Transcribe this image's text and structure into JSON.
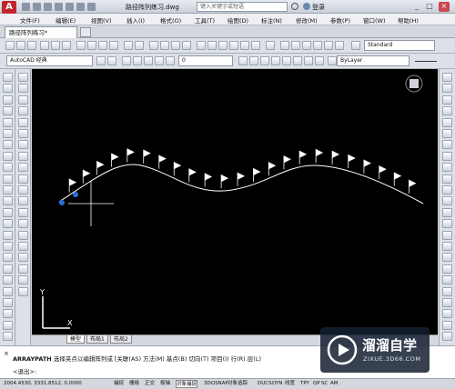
{
  "titlebar": {
    "logo": "A",
    "document_title": "路径阵列练习.dwg",
    "search_placeholder": "键入关键字或短语",
    "login": "登录",
    "min": "_",
    "max": "□",
    "close": "×"
  },
  "menu": [
    "文件(F)",
    "编辑(E)",
    "视图(V)",
    "插入(I)",
    "格式(O)",
    "工具(T)",
    "绘图(D)",
    "标注(N)",
    "修改(M)",
    "参数(P)",
    "窗口(W)",
    "帮助(H)"
  ],
  "file_tab": {
    "label": "路径阵列练习*"
  },
  "toolbar1": {
    "text_style": "Standard"
  },
  "toolbar2": {
    "workspace": "AutoCAD 经典",
    "layer": "0",
    "color": "ByLayer"
  },
  "canvas": {
    "axis_y": "Y",
    "axis_x": "X",
    "flag_count": 23,
    "colors": {
      "background": "#000000",
      "path": "#ffffff",
      "grip": "#2a6fd8"
    }
  },
  "layout_tabs": [
    "模型",
    "布局1",
    "布局2"
  ],
  "command": {
    "line1_prefix": "ARRAYPATH",
    "line1_text": "选择夹点以编辑阵列或 [关联(AS) 方法(M) 基点(B) 切向(T) 项目(I) 行(R) 层(L)",
    "line2_text": "<退出>:"
  },
  "status": {
    "coords": "2004.4530,  3331.8512,  0.0000",
    "buttons": [
      "捕捉",
      "栅格",
      "正交",
      "极轴",
      "对象捕捉",
      "3DOSNAP",
      "对象追踪",
      "DUCS",
      "DYN",
      "线宽",
      "TPY",
      "QP",
      "SC",
      "AM"
    ]
  },
  "watermark": {
    "brand": "溜溜自学",
    "url": "ZIXUE.3D66.COM"
  }
}
